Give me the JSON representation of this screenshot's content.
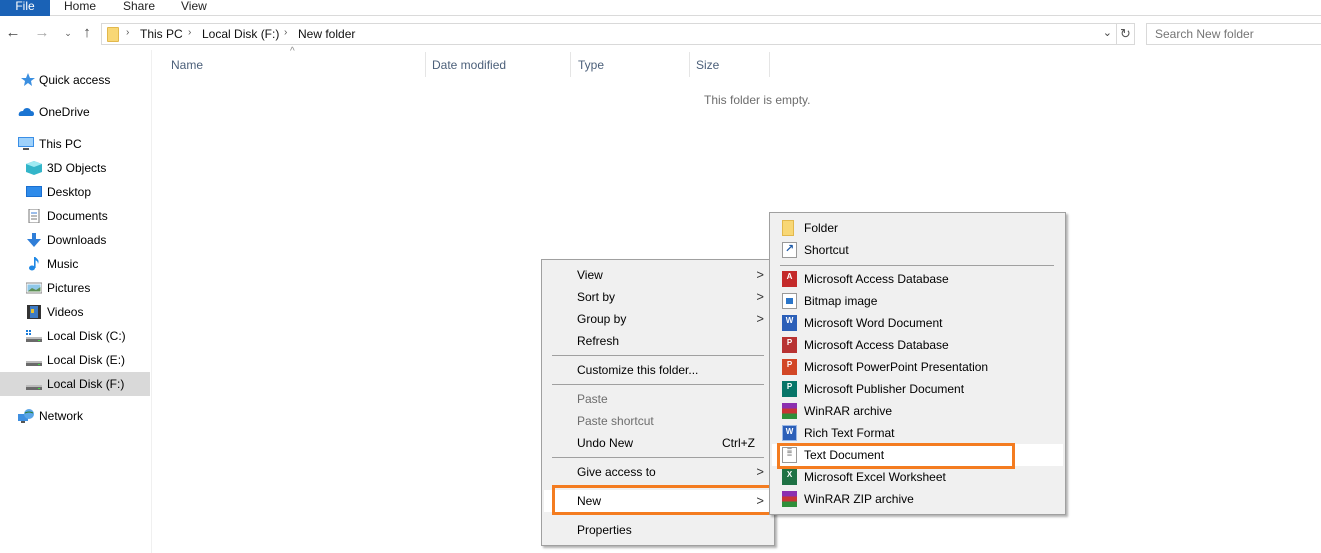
{
  "ribbon": {
    "tabs": [
      "File",
      "Home",
      "Share",
      "View"
    ],
    "accent_color": "#1a62b6"
  },
  "nav": {
    "back_icon": "arrow-left-icon",
    "forward_icon": "arrow-right-icon",
    "recent_icon": "chevron-down-icon",
    "up_icon": "arrow-up-icon",
    "breadcrumb": [
      "This PC",
      "Local Disk (F:)",
      "New folder"
    ],
    "refresh_icon": "refresh-icon",
    "search_placeholder": "Search New folder"
  },
  "sidebar": {
    "items": [
      {
        "label": "Quick access",
        "icon": "star-icon"
      },
      {
        "label": "OneDrive",
        "icon": "cloud-icon"
      },
      {
        "label": "This PC",
        "icon": "monitor-icon"
      },
      {
        "label": "3D Objects",
        "icon": "cube-icon"
      },
      {
        "label": "Desktop",
        "icon": "desktop-icon"
      },
      {
        "label": "Documents",
        "icon": "document-icon"
      },
      {
        "label": "Downloads",
        "icon": "download-icon"
      },
      {
        "label": "Music",
        "icon": "music-note-icon"
      },
      {
        "label": "Pictures",
        "icon": "picture-icon"
      },
      {
        "label": "Videos",
        "icon": "film-icon"
      },
      {
        "label": "Local Disk (C:)",
        "icon": "drive-icon"
      },
      {
        "label": "Local Disk (E:)",
        "icon": "drive-icon"
      },
      {
        "label": "Local Disk (F:)",
        "icon": "drive-icon",
        "selected": true
      },
      {
        "label": "Network",
        "icon": "network-icon"
      }
    ]
  },
  "content": {
    "columns": [
      "Name",
      "Date modified",
      "Type",
      "Size"
    ],
    "empty_message": "This folder is empty."
  },
  "context_menu": {
    "items": [
      {
        "label": "View",
        "submenu": true
      },
      {
        "label": "Sort by",
        "submenu": true
      },
      {
        "label": "Group by",
        "submenu": true
      },
      {
        "label": "Refresh"
      },
      {
        "label": "Customize this folder..."
      },
      {
        "label": "Paste",
        "disabled": true
      },
      {
        "label": "Paste shortcut",
        "disabled": true
      },
      {
        "label": "Undo New",
        "shortcut": "Ctrl+Z"
      },
      {
        "label": "Give access to",
        "submenu": true
      },
      {
        "label": "New",
        "submenu": true,
        "highlighted": true
      },
      {
        "label": "Properties"
      }
    ]
  },
  "new_submenu": {
    "items": [
      {
        "label": "Folder",
        "icon": "folder-icon"
      },
      {
        "label": "Shortcut",
        "icon": "shortcut-icon"
      },
      {
        "label": "Microsoft Access Database",
        "icon": "access-icon"
      },
      {
        "label": "Bitmap image",
        "icon": "bitmap-icon"
      },
      {
        "label": "Microsoft Word Document",
        "icon": "word-icon"
      },
      {
        "label": "Microsoft Access Database",
        "icon": "access-icon"
      },
      {
        "label": "Microsoft PowerPoint Presentation",
        "icon": "powerpoint-icon"
      },
      {
        "label": "Microsoft Publisher Document",
        "icon": "publisher-icon"
      },
      {
        "label": "WinRAR archive",
        "icon": "winrar-icon"
      },
      {
        "label": "Rich Text Format",
        "icon": "rtf-icon"
      },
      {
        "label": "Text Document",
        "icon": "text-file-icon",
        "highlighted": true
      },
      {
        "label": "Microsoft Excel Worksheet",
        "icon": "excel-icon"
      },
      {
        "label": "WinRAR ZIP archive",
        "icon": "winrar-icon"
      }
    ]
  },
  "highlight_color": "#f47c20"
}
